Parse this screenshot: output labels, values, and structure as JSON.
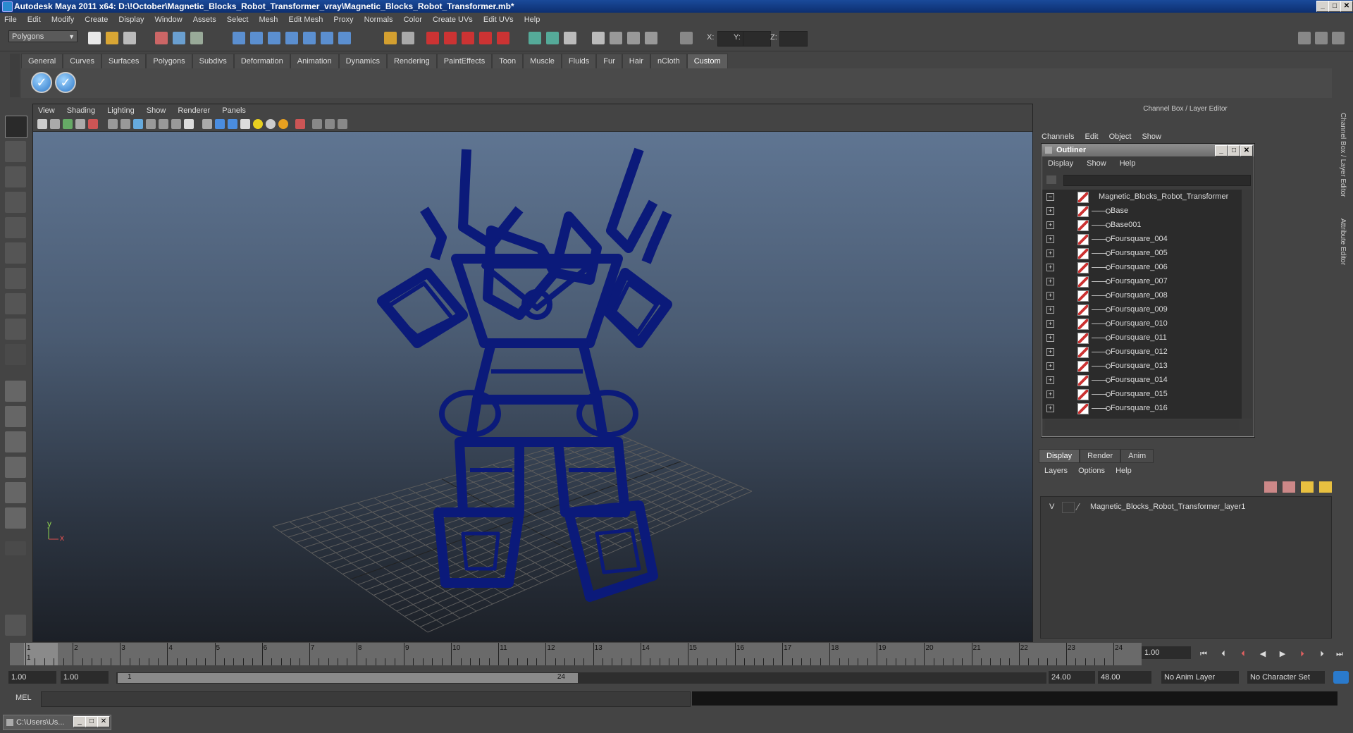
{
  "window": {
    "title": "Autodesk Maya 2011 x64: D:\\!October\\Magnetic_Blocks_Robot_Transformer_vray\\Magnetic_Blocks_Robot_Transformer.mb*",
    "min": "_",
    "max": "□",
    "close": "✕"
  },
  "menubar": [
    "File",
    "Edit",
    "Modify",
    "Create",
    "Display",
    "Window",
    "Assets",
    "Select",
    "Mesh",
    "Edit Mesh",
    "Proxy",
    "Normals",
    "Color",
    "Create UVs",
    "Edit UVs",
    "Help"
  ],
  "statusline": {
    "mode": "Polygons",
    "x_label": "X:",
    "y_label": "Y:",
    "z_label": "Z:"
  },
  "shelf": {
    "tabs": [
      "General",
      "Curves",
      "Surfaces",
      "Polygons",
      "Subdivs",
      "Deformation",
      "Animation",
      "Dynamics",
      "Rendering",
      "PaintEffects",
      "Toon",
      "Muscle",
      "Fluids",
      "Fur",
      "Hair",
      "nCloth",
      "Custom"
    ],
    "active_tab": "Custom"
  },
  "viewport": {
    "menu": [
      "View",
      "Shading",
      "Lighting",
      "Show",
      "Renderer",
      "Panels"
    ],
    "axis_x": "x",
    "axis_y": "y",
    "wire_color": "#0b1a7a"
  },
  "channelbox": {
    "title": "Channel Box / Layer Editor",
    "menu": [
      "Channels",
      "Edit",
      "Object",
      "Show"
    ],
    "side_tab_1": "Channel Box / Layer Editor",
    "side_tab_2": "Attribute Editor"
  },
  "outliner": {
    "title": "Outliner",
    "menu": [
      "Display",
      "Show",
      "Help"
    ],
    "items": [
      {
        "label": "Magnetic_Blocks_Robot_Transformer",
        "expand": "−"
      },
      {
        "label": "Base",
        "expand": "+"
      },
      {
        "label": "Base001",
        "expand": "+"
      },
      {
        "label": "Foursquare_004",
        "expand": "+"
      },
      {
        "label": "Foursquare_005",
        "expand": "+"
      },
      {
        "label": "Foursquare_006",
        "expand": "+"
      },
      {
        "label": "Foursquare_007",
        "expand": "+"
      },
      {
        "label": "Foursquare_008",
        "expand": "+"
      },
      {
        "label": "Foursquare_009",
        "expand": "+"
      },
      {
        "label": "Foursquare_010",
        "expand": "+"
      },
      {
        "label": "Foursquare_011",
        "expand": "+"
      },
      {
        "label": "Foursquare_012",
        "expand": "+"
      },
      {
        "label": "Foursquare_013",
        "expand": "+"
      },
      {
        "label": "Foursquare_014",
        "expand": "+"
      },
      {
        "label": "Foursquare_015",
        "expand": "+"
      },
      {
        "label": "Foursquare_016",
        "expand": "+"
      }
    ]
  },
  "layereditor": {
    "tabs": [
      "Display",
      "Render",
      "Anim"
    ],
    "active_tab": "Display",
    "menu": [
      "Layers",
      "Options",
      "Help"
    ],
    "layer_visibility": "V",
    "layer_name": "Magnetic_Blocks_Robot_Transformer_layer1"
  },
  "timeline": {
    "ticks": [
      "1",
      "2",
      "3",
      "4",
      "5",
      "6",
      "7",
      "8",
      "9",
      "10",
      "11",
      "12",
      "13",
      "14",
      "15",
      "16",
      "17",
      "18",
      "19",
      "20",
      "21",
      "22",
      "23",
      "24"
    ],
    "current_frame_marker": "1",
    "current_frame": "1.00"
  },
  "range": {
    "start": "1.00",
    "playback_start": "1.00",
    "slider_start": "1",
    "slider_end": "24",
    "playback_end": "24.00",
    "end": "48.00",
    "anim_layer": "No Anim Layer",
    "character_set": "No Character Set"
  },
  "cmdline": {
    "label": "MEL"
  },
  "taskbar": {
    "item": "C:\\Users\\Us..."
  }
}
